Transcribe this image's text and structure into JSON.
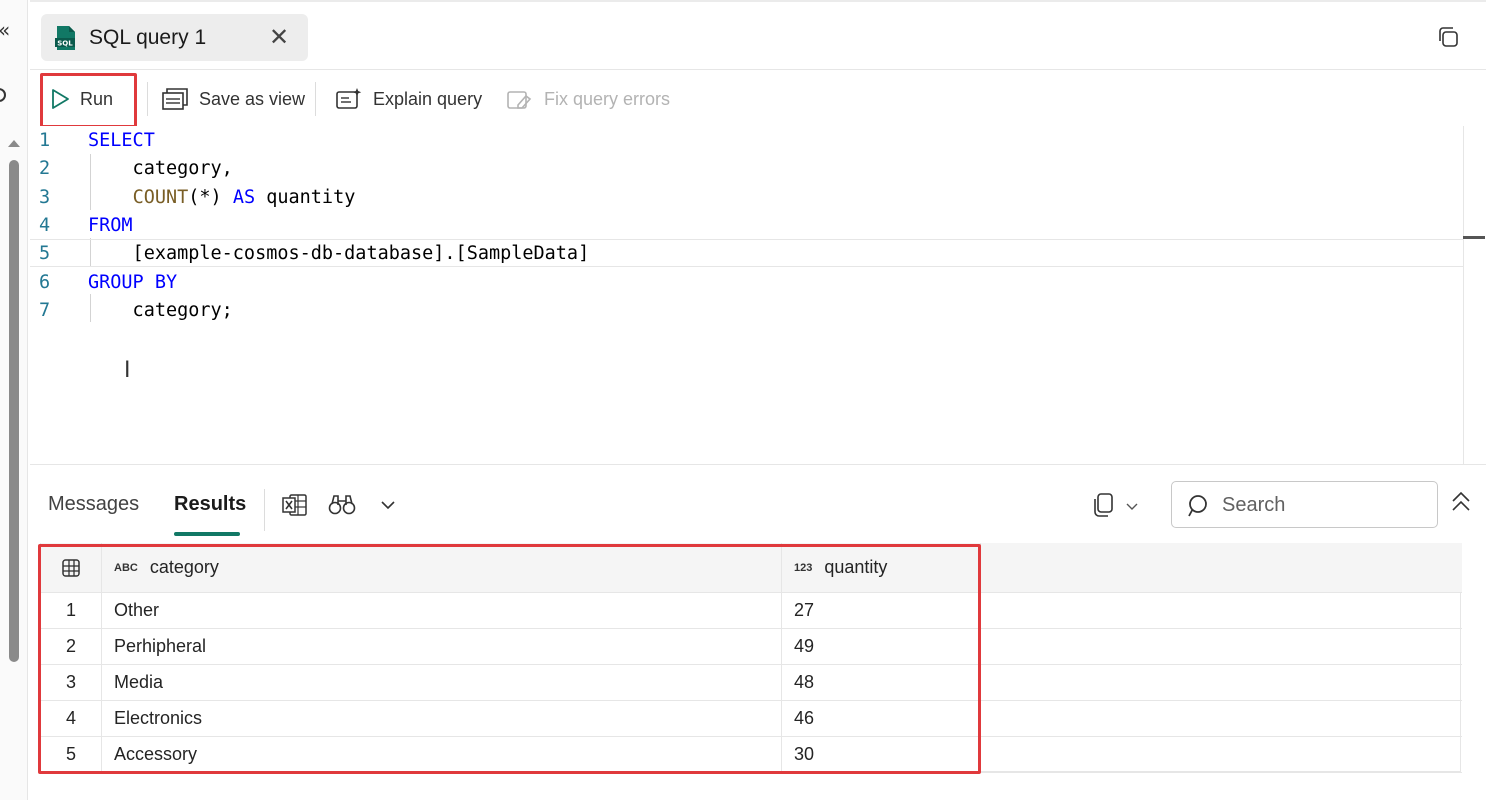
{
  "tab": {
    "title": "SQL query 1",
    "close_icon": "close-icon"
  },
  "toolbar": {
    "run_label": "Run",
    "save_view_label": "Save as view",
    "explain_label": "Explain query",
    "fix_label": "Fix query errors"
  },
  "editor": {
    "lines": [
      {
        "num": "1",
        "tokens": [
          {
            "t": "SELECT",
            "c": "kw"
          }
        ]
      },
      {
        "num": "2",
        "tokens": [
          {
            "t": "    category,",
            "c": "txt"
          }
        ]
      },
      {
        "num": "3",
        "tokens": [
          {
            "t": "    ",
            "c": "txt"
          },
          {
            "t": "COUNT",
            "c": "fn"
          },
          {
            "t": "(*) ",
            "c": "txt"
          },
          {
            "t": "AS",
            "c": "kw"
          },
          {
            "t": " quantity",
            "c": "txt"
          }
        ]
      },
      {
        "num": "4",
        "tokens": [
          {
            "t": "FROM",
            "c": "kw"
          }
        ]
      },
      {
        "num": "5",
        "tokens": [
          {
            "t": "    [example-cosmos-db-database].[SampleData]",
            "c": "txt"
          }
        ]
      },
      {
        "num": "6",
        "tokens": [
          {
            "t": "GROUP BY",
            "c": "kw"
          }
        ]
      },
      {
        "num": "7",
        "tokens": [
          {
            "t": "    category;",
            "c": "txt"
          }
        ]
      }
    ]
  },
  "results": {
    "tabs": [
      {
        "label": "Messages",
        "active": false
      },
      {
        "label": "Results",
        "active": true
      }
    ],
    "search_placeholder": "Search",
    "columns": [
      {
        "type_tag": "ABC",
        "label": "category"
      },
      {
        "type_tag": "123",
        "label": "quantity"
      }
    ],
    "rows": [
      {
        "idx": "1",
        "category": "Other",
        "quantity": "27"
      },
      {
        "idx": "2",
        "category": "Perhipheral",
        "quantity": "49"
      },
      {
        "idx": "3",
        "category": "Media",
        "quantity": "48"
      },
      {
        "idx": "4",
        "category": "Electronics",
        "quantity": "46"
      },
      {
        "idx": "5",
        "category": "Accessory",
        "quantity": "30"
      }
    ]
  },
  "colors": {
    "accent": "#117865",
    "highlight": "#e0393c",
    "keyword": "#0000ff",
    "function": "#795e26"
  }
}
